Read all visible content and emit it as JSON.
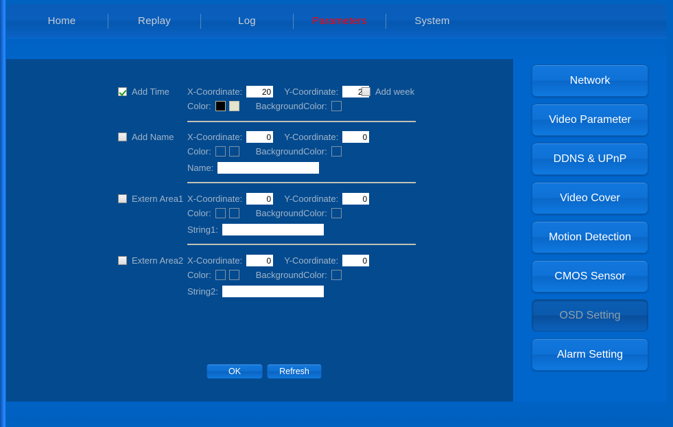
{
  "nav": {
    "items": [
      {
        "label": "Home",
        "active": false
      },
      {
        "label": "Replay",
        "active": false
      },
      {
        "label": "Log",
        "active": false
      },
      {
        "label": "Parameters",
        "active": true
      },
      {
        "label": "System",
        "active": false
      }
    ],
    "active_color": "#ff0000",
    "inactive_color": "#c9ced6"
  },
  "sidebar": {
    "items": [
      {
        "label": "Network",
        "active": false
      },
      {
        "label": "Video Parameter",
        "active": false
      },
      {
        "label": "DDNS & UPnP",
        "active": false
      },
      {
        "label": "Video Cover",
        "active": false
      },
      {
        "label": "Motion Detection",
        "active": false
      },
      {
        "label": "CMOS Sensor",
        "active": false
      },
      {
        "label": "OSD Setting",
        "active": true
      },
      {
        "label": "Alarm Setting",
        "active": false
      }
    ]
  },
  "form": {
    "labels": {
      "x_coordinate": "X-Coordinate:",
      "y_coordinate": "Y-Coordinate:",
      "color": "Color:",
      "background_color": "BackgroundColor:"
    },
    "rows": [
      {
        "checkbox_label": "Add Time",
        "checked": true,
        "x_value": "20",
        "y_value": "20",
        "extra_checkbox_label": "Add week",
        "extra_checked": false,
        "color_swatch_1": "#000000",
        "color_swatch_2": "#e4e4cc",
        "background_swatch": "",
        "text_field_label": "",
        "text_field_value": ""
      },
      {
        "checkbox_label": "Add Name",
        "checked": false,
        "x_value": "0",
        "y_value": "0",
        "extra_checkbox_label": "",
        "extra_checked": false,
        "color_swatch_1": "",
        "color_swatch_2": "",
        "background_swatch": "",
        "text_field_label": "Name:",
        "text_field_value": ""
      },
      {
        "checkbox_label": "Extern Area1",
        "checked": false,
        "x_value": "0",
        "y_value": "0",
        "extra_checkbox_label": "",
        "extra_checked": false,
        "color_swatch_1": "",
        "color_swatch_2": "",
        "background_swatch": "",
        "text_field_label": "String1:",
        "text_field_value": ""
      },
      {
        "checkbox_label": "Extern Area2",
        "checked": false,
        "x_value": "0",
        "y_value": "0",
        "extra_checkbox_label": "",
        "extra_checked": false,
        "color_swatch_1": "",
        "color_swatch_2": "",
        "background_swatch": "",
        "text_field_label": "String2:",
        "text_field_value": ""
      }
    ],
    "buttons": {
      "ok": "OK",
      "refresh": "Refresh"
    }
  },
  "theme": {
    "page_background": "#0062c0",
    "panel_background": "#044a8f",
    "sidebar_background": "#0066cc",
    "label_color": "#9fb4c9",
    "separator_color": "#c2c2b4",
    "button_blue": "#0f70d2"
  }
}
